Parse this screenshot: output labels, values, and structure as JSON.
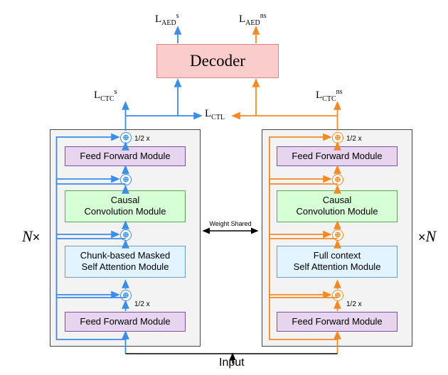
{
  "losses": {
    "L_AED_s": "L",
    "L_AED_s_sub": "AED",
    "L_AED_s_sup": "s",
    "L_AED_ns": "L",
    "L_AED_ns_sub": "AED",
    "L_AED_ns_sup": "ns",
    "L_CTC_s": "L",
    "L_CTC_s_sub": "CTC",
    "L_CTC_s_sup": "s",
    "L_CTC_ns": "L",
    "L_CTC_ns_sub": "CTC",
    "L_CTC_ns_sup": "ns",
    "L_CTL": "L",
    "L_CTL_sub": "CTL"
  },
  "decoder_label": "Decoder",
  "left_modules": {
    "ff_top": "Feed Forward Module",
    "conv": "Causal\nConvolution Module",
    "attn": "Chunk-based Masked\nSelf Attention Module",
    "ff_bottom": "Feed Forward Module"
  },
  "right_modules": {
    "ff_top": "Feed Forward Module",
    "conv": "Causal\nConvolution Module",
    "attn": "Full context\nSelf Attention Module",
    "ff_bottom": "Feed Forward Module"
  },
  "half": "1/2 x",
  "weight_shared": "Weight Shared",
  "side_n": "N",
  "side_mult": "×",
  "input": "Input"
}
